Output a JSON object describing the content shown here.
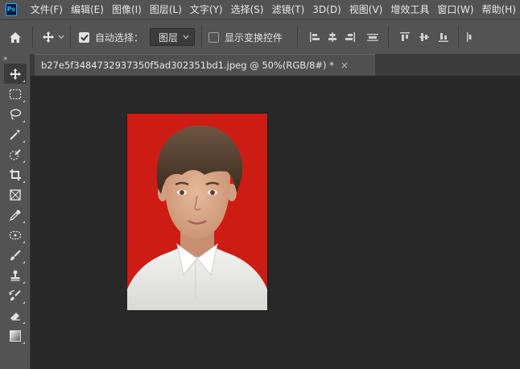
{
  "app": {
    "logo_text": "Ps"
  },
  "menu": [
    "文件(F)",
    "编辑(E)",
    "图像(I)",
    "图层(L)",
    "文字(Y)",
    "选择(S)",
    "滤镜(T)",
    "3D(D)",
    "视图(V)",
    "增效工具",
    "窗口(W)",
    "帮助(H)"
  ],
  "options": {
    "auto_select_label": "自动选择：",
    "auto_select_checked": true,
    "auto_select_target": "图层",
    "show_transform_label": "显示变换控件",
    "show_transform_checked": false
  },
  "document": {
    "tab_title": "b27e5f3484732937350f5ad302351bd1.jpeg @ 50%(RGB/8#) *",
    "close_glyph": "×"
  },
  "toolbar": {
    "tools": [
      "move-tool",
      "rectangular-marquee-tool",
      "lasso-tool",
      "magic-wand-tool",
      "quick-selection-tool",
      "crop-tool",
      "frame-tool",
      "eyedropper-tool",
      "spot-healing-tool",
      "brush-tool",
      "clone-stamp-tool",
      "history-brush-tool",
      "eraser-tool",
      "gradient-tool"
    ],
    "active_tool": "move-tool"
  },
  "colors": {
    "photo_background": "#cd1c14",
    "accent": "#31a8ff"
  }
}
